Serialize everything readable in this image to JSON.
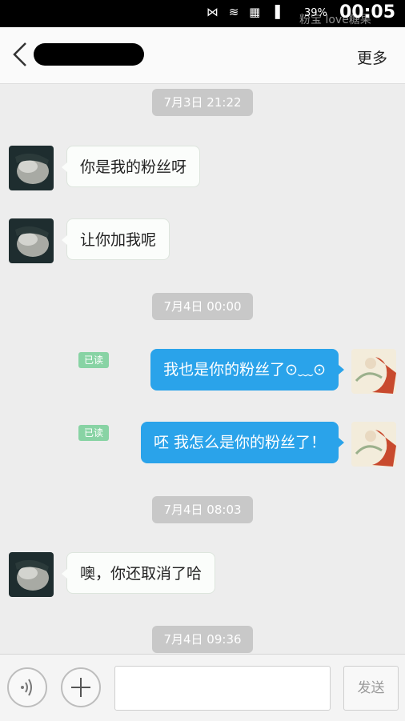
{
  "status_bar": {
    "time": "00:05",
    "battery": "39%",
    "watermark": "粉宝 love糖果",
    "icons": [
      "nfc-icon",
      "wifi-icon",
      "sim-icon",
      "signal-icon"
    ]
  },
  "header": {
    "more_label": "更多"
  },
  "messages": {
    "ts1": "7月3日 21:22",
    "m1": "你是我的粉丝呀",
    "m2": "让你加我呢",
    "ts2": "7月4日 00:00",
    "m3": "我也是你的粉丝了⊙﹏⊙",
    "m3_status": "已读",
    "m4": "呸 我怎么是你的粉丝了！",
    "m4_status": "已读",
    "ts3": "7月4日 08:03",
    "m5": "噢，你还取消了哈",
    "ts4": "7月4日 09:36"
  },
  "input_bar": {
    "text_value": "",
    "send_label": "发送"
  },
  "colors": {
    "outgoing_bubble": "#2aa3ea",
    "read_badge": "#88d3a4",
    "timestamp_bg": "#c8c8c8"
  }
}
